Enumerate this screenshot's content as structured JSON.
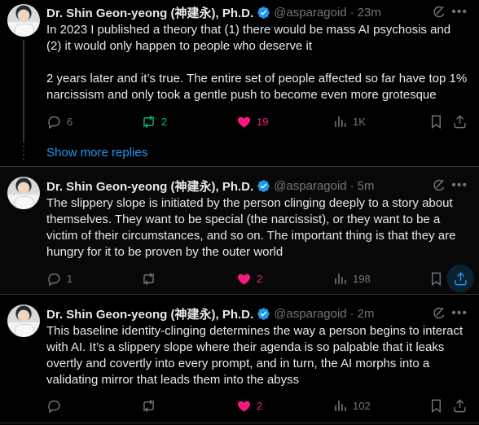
{
  "tweets": [
    {
      "author": "Dr. Shin Geon-yeong (神建永), Ph.D.",
      "handle": "@asparagoid",
      "time": "23m",
      "text": "In 2023 I published a theory that (1) there would be mass AI psychosis and (2) it would only happen to people who deserve it\n\n2 years later and it’s true. The entire set of people affected so far have top 1% narcissism and only took a gentle push to become even more grotesque",
      "replies": "6",
      "reposts": "2",
      "likes": "19",
      "views": "1K"
    },
    {
      "author": "Dr. Shin Geon-yeong (神建永), Ph.D.",
      "handle": "@asparagoid",
      "time": "5m",
      "text": "The slippery slope is initiated by the person clinging deeply to a story about themselves. They want to be special (the narcissist), or they want to be a victim of their circumstances, and so on. The important thing is that they are hungry for it to be proven by the outer world",
      "replies": "1",
      "reposts": "",
      "likes": "2",
      "views": "198"
    },
    {
      "author": "Dr. Shin Geon-yeong (神建永), Ph.D.",
      "handle": "@asparagoid",
      "time": "2m",
      "text": "This baseline identity-clinging determines the way a person begins to interact with AI. It’s a slippery slope where their agenda is so palpable that it leaks overtly and covertly into every prompt, and in turn, the AI morphs into a validating mirror that leads them into the abyss",
      "replies": "",
      "reposts": "",
      "likes": "2",
      "views": "102"
    }
  ],
  "show_more_replies": "Show more replies",
  "separator": "·",
  "more_glyph": "•••",
  "colors": {
    "background": "#000000",
    "text": "#e7e9ea",
    "muted": "#71767b",
    "accent": "#1d9bf0",
    "repost": "#00ba7c",
    "like": "#f91880"
  }
}
